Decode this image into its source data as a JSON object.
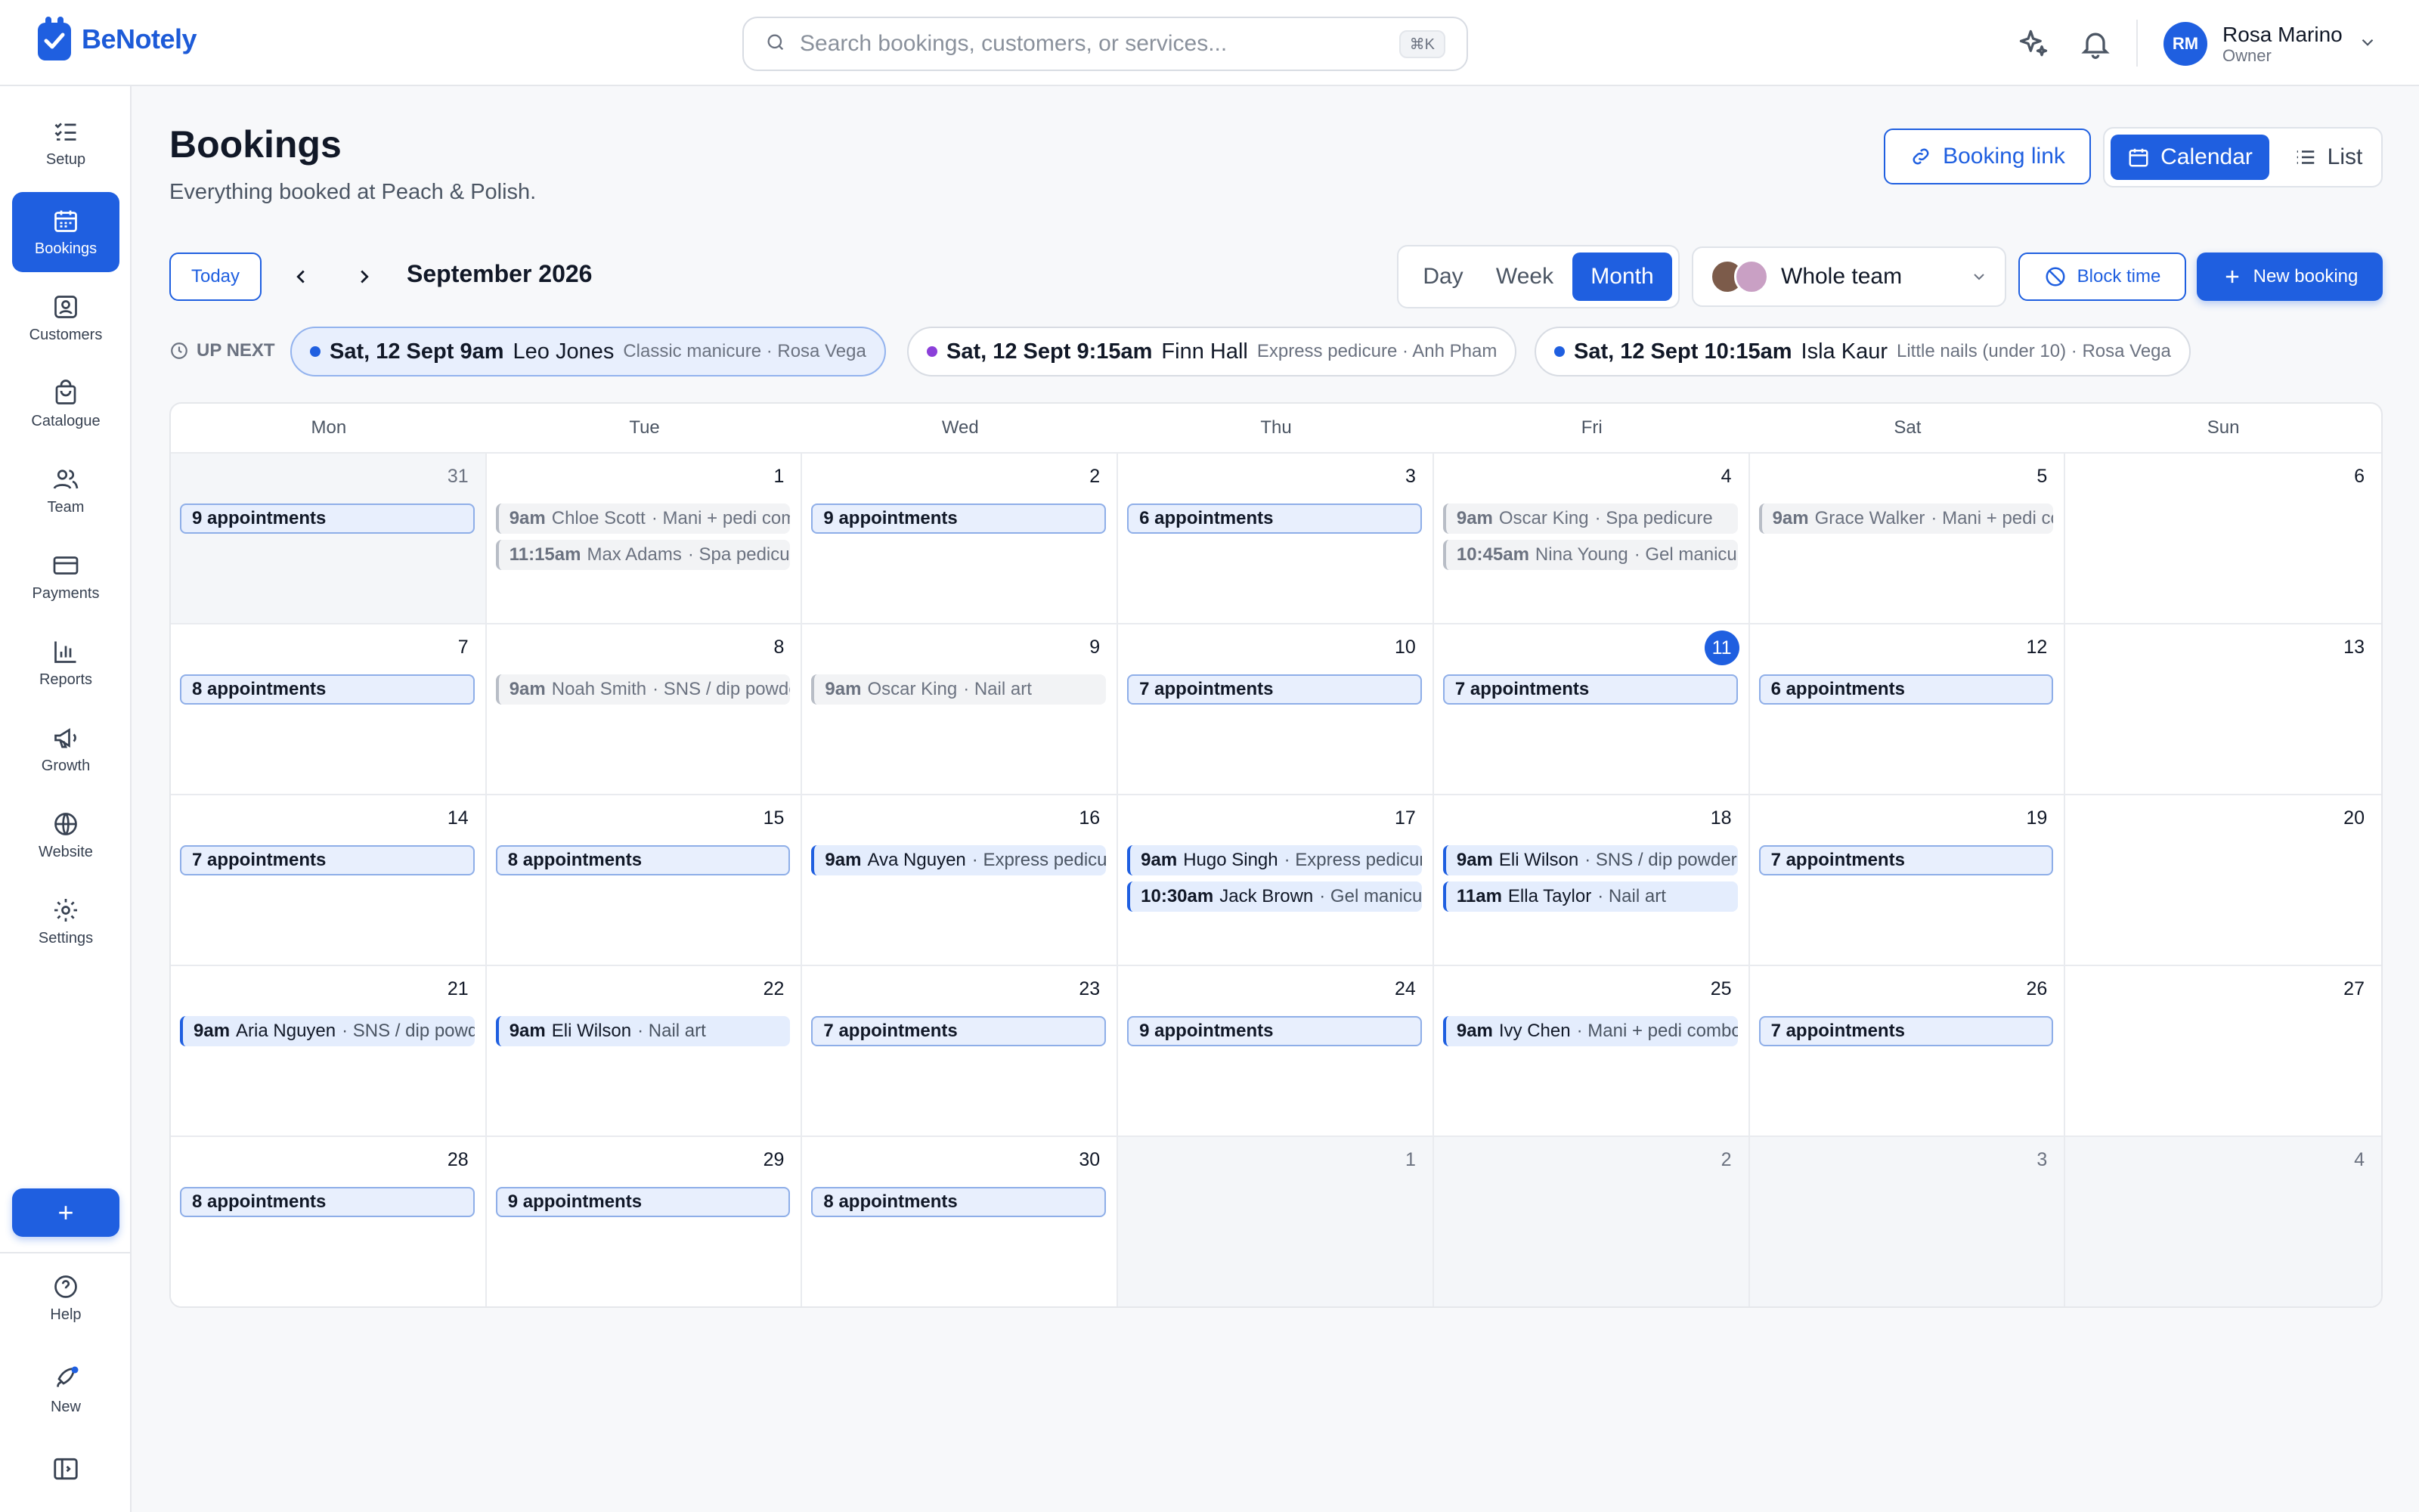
{
  "app": {
    "name": "BeNotely"
  },
  "search": {
    "placeholder": "Search bookings, customers, or services...",
    "shortcut": "⌘K"
  },
  "user": {
    "initials": "RM",
    "name": "Rosa Marino",
    "role": "Owner"
  },
  "sidebar": {
    "items": [
      {
        "label": "Setup",
        "icon": "checklist-icon"
      },
      {
        "label": "Bookings",
        "icon": "calendar-icon",
        "active": true
      },
      {
        "label": "Customers",
        "icon": "contact-card-icon"
      },
      {
        "label": "Catalogue",
        "icon": "shopping-bag-icon"
      },
      {
        "label": "Team",
        "icon": "users-icon"
      },
      {
        "label": "Payments",
        "icon": "credit-card-icon"
      },
      {
        "label": "Reports",
        "icon": "bar-chart-icon"
      },
      {
        "label": "Growth",
        "icon": "megaphone-icon"
      },
      {
        "label": "Website",
        "icon": "globe-icon"
      },
      {
        "label": "Settings",
        "icon": "gear-icon"
      }
    ],
    "add_label": "+",
    "help_label": "Help",
    "new_label": "New"
  },
  "header": {
    "title": "Bookings",
    "subtitle": "Everything booked at Peach & Polish.",
    "booking_link_label": "Booking link",
    "calendar_label": "Calendar",
    "list_label": "List"
  },
  "toolbar": {
    "today_label": "Today",
    "month_label": "September 2026",
    "range": [
      "Day",
      "Week",
      "Month"
    ],
    "range_selected": "Month",
    "team_label": "Whole team",
    "block_label": "Block time",
    "new_label": "New booking"
  },
  "upnext": {
    "label": "UP NEXT",
    "items": [
      {
        "when": "Sat, 12 Sept 9am",
        "who": "Leo Jones",
        "what": "Classic manicure · Rosa Vega",
        "dot": "#1f5fe0"
      },
      {
        "when": "Sat, 12 Sept 9:15am",
        "who": "Finn Hall",
        "what": "Express pedicure · Anh Pham",
        "dot": "#8b3fd9"
      },
      {
        "when": "Sat, 12 Sept 10:15am",
        "who": "Isla Kaur",
        "what": "Little nails (under 10) · Rosa Vega",
        "dot": "#1f5fe0"
      }
    ]
  },
  "calendar": {
    "weekdays": [
      "Mon",
      "Tue",
      "Wed",
      "Thu",
      "Fri",
      "Sat",
      "Sun"
    ],
    "today": "11",
    "weeks": [
      [
        {
          "day": "31",
          "out": true,
          "events": [
            {
              "kind": "sum",
              "text": "9 appointments"
            }
          ]
        },
        {
          "day": "1",
          "events": [
            {
              "kind": "past",
              "time": "9am",
              "name": "Chloe Scott",
              "svc": "· Mani + pedi combo"
            },
            {
              "kind": "past",
              "time": "11:15am",
              "name": "Max Adams",
              "svc": "· Spa pedicure"
            }
          ]
        },
        {
          "day": "2",
          "events": [
            {
              "kind": "sum",
              "text": "9 appointments"
            }
          ]
        },
        {
          "day": "3",
          "events": [
            {
              "kind": "sum",
              "text": "6 appointments"
            }
          ]
        },
        {
          "day": "4",
          "events": [
            {
              "kind": "past",
              "time": "9am",
              "name": "Oscar King",
              "svc": "· Spa pedicure"
            },
            {
              "kind": "past",
              "time": "10:45am",
              "name": "Nina Young",
              "svc": "· Gel manicure"
            }
          ]
        },
        {
          "day": "5",
          "events": [
            {
              "kind": "past",
              "time": "9am",
              "name": "Grace Walker",
              "svc": "· Mani + pedi combo"
            }
          ]
        },
        {
          "day": "6",
          "events": []
        }
      ],
      [
        {
          "day": "7",
          "events": [
            {
              "kind": "sum",
              "text": "8 appointments"
            }
          ]
        },
        {
          "day": "8",
          "events": [
            {
              "kind": "past",
              "time": "9am",
              "name": "Noah Smith",
              "svc": "· SNS / dip powder"
            }
          ]
        },
        {
          "day": "9",
          "events": [
            {
              "kind": "past",
              "time": "9am",
              "name": "Oscar King",
              "svc": "· Nail art"
            }
          ]
        },
        {
          "day": "10",
          "events": [
            {
              "kind": "sum",
              "text": "7 appointments"
            }
          ]
        },
        {
          "day": "11",
          "events": [
            {
              "kind": "sum",
              "text": "7 appointments"
            }
          ]
        },
        {
          "day": "12",
          "events": [
            {
              "kind": "sum",
              "text": "6 appointments"
            }
          ]
        },
        {
          "day": "13",
          "events": []
        }
      ],
      [
        {
          "day": "14",
          "events": [
            {
              "kind": "sum",
              "text": "7 appointments"
            }
          ]
        },
        {
          "day": "15",
          "events": [
            {
              "kind": "sum",
              "text": "8 appointments"
            }
          ]
        },
        {
          "day": "16",
          "events": [
            {
              "kind": "up",
              "time": "9am",
              "name": "Ava Nguyen",
              "svc": "· Express pedicure"
            }
          ]
        },
        {
          "day": "17",
          "events": [
            {
              "kind": "up",
              "time": "9am",
              "name": "Hugo Singh",
              "svc": "· Express pedicure"
            },
            {
              "kind": "up",
              "time": "10:30am",
              "name": "Jack Brown",
              "svc": "· Gel manicure"
            }
          ]
        },
        {
          "day": "18",
          "events": [
            {
              "kind": "up",
              "time": "9am",
              "name": "Eli Wilson",
              "svc": "· SNS / dip powder"
            },
            {
              "kind": "up",
              "time": "11am",
              "name": "Ella Taylor",
              "svc": "· Nail art"
            }
          ]
        },
        {
          "day": "19",
          "events": [
            {
              "kind": "sum",
              "text": "7 appointments"
            }
          ]
        },
        {
          "day": "20",
          "events": []
        }
      ],
      [
        {
          "day": "21",
          "events": [
            {
              "kind": "up",
              "time": "9am",
              "name": "Aria Nguyen",
              "svc": "· SNS / dip powder"
            }
          ]
        },
        {
          "day": "22",
          "events": [
            {
              "kind": "up",
              "time": "9am",
              "name": "Eli Wilson",
              "svc": "· Nail art"
            }
          ]
        },
        {
          "day": "23",
          "events": [
            {
              "kind": "sum",
              "text": "7 appointments"
            }
          ]
        },
        {
          "day": "24",
          "events": [
            {
              "kind": "sum",
              "text": "9 appointments"
            }
          ]
        },
        {
          "day": "25",
          "events": [
            {
              "kind": "up",
              "time": "9am",
              "name": "Ivy Chen",
              "svc": "· Mani + pedi combo"
            }
          ]
        },
        {
          "day": "26",
          "events": [
            {
              "kind": "sum",
              "text": "7 appointments"
            }
          ]
        },
        {
          "day": "27",
          "events": []
        }
      ],
      [
        {
          "day": "28",
          "events": [
            {
              "kind": "sum",
              "text": "8 appointments"
            }
          ]
        },
        {
          "day": "29",
          "events": [
            {
              "kind": "sum",
              "text": "9 appointments"
            }
          ]
        },
        {
          "day": "30",
          "events": [
            {
              "kind": "sum",
              "text": "8 appointments"
            }
          ]
        },
        {
          "day": "1",
          "out": true,
          "events": []
        },
        {
          "day": "2",
          "out": true,
          "events": []
        },
        {
          "day": "3",
          "out": true,
          "events": []
        },
        {
          "day": "4",
          "out": true,
          "events": []
        }
      ]
    ]
  },
  "colors": {
    "accent": "#1f5fe0",
    "border": "#e5e7eb"
  }
}
